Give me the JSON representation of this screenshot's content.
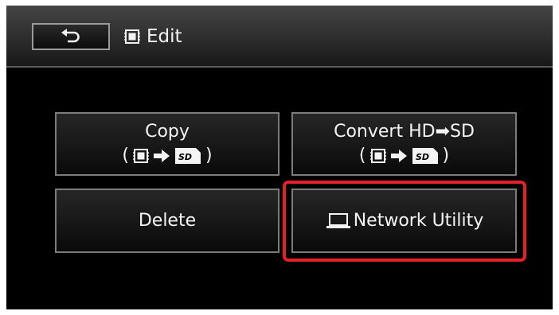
{
  "header": {
    "back_icon": "return-arrow-icon",
    "mode_icon": "memory-icon",
    "title": "Edit"
  },
  "menu": {
    "copy": {
      "label": "Copy",
      "open_paren": "(",
      "close_paren": ")"
    },
    "convert": {
      "label": "Convert HD➡SD",
      "open_paren": "(",
      "close_paren": ")"
    },
    "delete": {
      "label": "Delete"
    },
    "network": {
      "label": "Network Utility",
      "icon": "computer-icon"
    }
  },
  "colors": {
    "highlight": "#e5202a",
    "background": "#000000",
    "text": "#f4f4f4"
  }
}
